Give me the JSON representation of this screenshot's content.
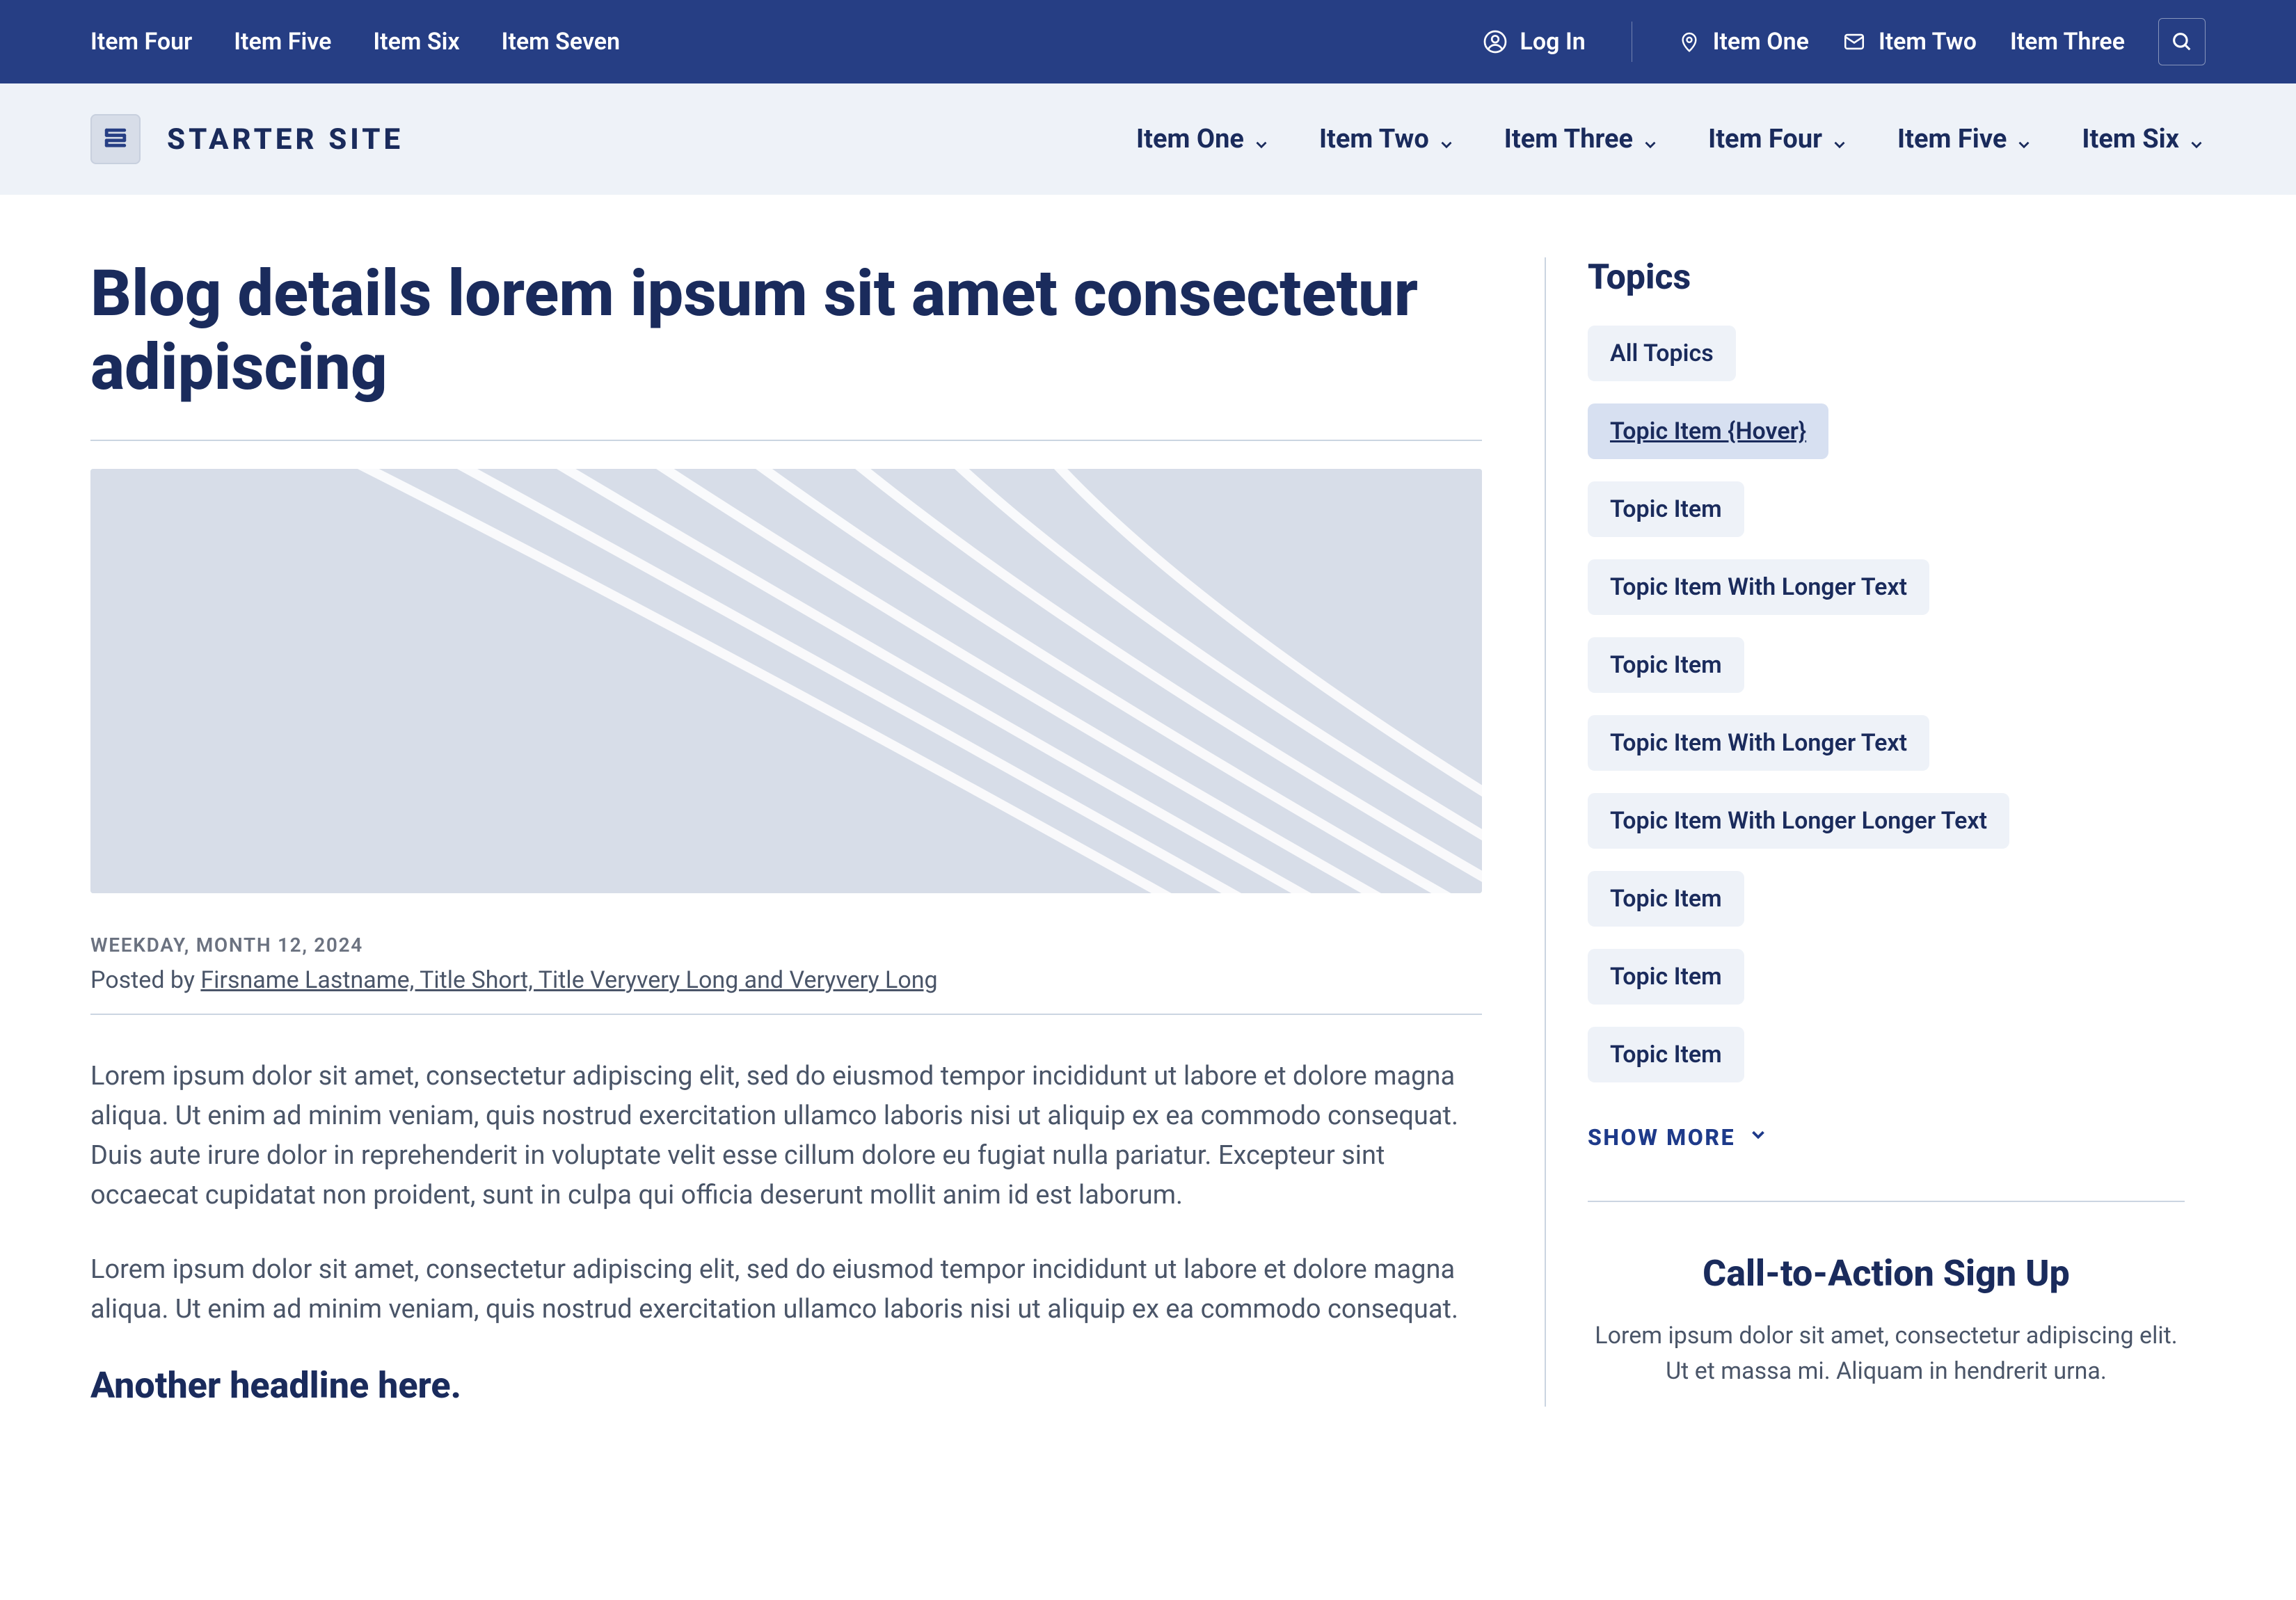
{
  "utility_bar": {
    "left_items": [
      {
        "label": "Item Four"
      },
      {
        "label": "Item Five"
      },
      {
        "label": "Item Six"
      },
      {
        "label": "Item Seven"
      }
    ],
    "login_label": "Log In",
    "right_items": [
      {
        "label": "Item One",
        "icon": "pin"
      },
      {
        "label": "Item Two",
        "icon": "mail"
      },
      {
        "label": "Item Three",
        "icon": null
      }
    ]
  },
  "brand": {
    "name": "STARTER SITE"
  },
  "main_nav": [
    {
      "label": "Item One"
    },
    {
      "label": "Item Two"
    },
    {
      "label": "Item Three"
    },
    {
      "label": "Item Four"
    },
    {
      "label": "Item Five"
    },
    {
      "label": "Item Six"
    }
  ],
  "article": {
    "title": "Blog details lorem ipsum sit amet consectetur adipiscing",
    "date": "WEEKDAY, MONTH 12, 2024",
    "byline_prefix": "Posted by ",
    "byline_link": "Firsname Lastname, Title Short, Title Veryvery Long and Veryvery Long",
    "paragraphs": [
      "Lorem ipsum dolor sit amet, consectetur adipiscing elit, sed do eiusmod tempor incididunt ut labore et dolore magna aliqua. Ut enim ad minim veniam, quis nostrud exercitation ullamco laboris nisi ut aliquip ex ea commodo consequat. Duis aute irure dolor in reprehenderit in voluptate velit esse cillum dolore eu fugiat nulla pariatur. Excepteur sint occaecat cupidatat non proident, sunt in culpa qui officia deserunt mollit anim id est laborum.",
      "Lorem ipsum dolor sit amet, consectetur adipiscing elit, sed do eiusmod tempor incididunt ut labore et dolore magna aliqua. Ut enim ad minim veniam, quis nostrud exercitation ullamco laboris nisi ut aliquip ex ea commodo consequat."
    ],
    "subheading": "Another headline here."
  },
  "sidebar": {
    "topics_heading": "Topics",
    "topics": [
      {
        "label": "All Topics",
        "state": "normal"
      },
      {
        "label": "Topic Item {Hover}",
        "state": "hover"
      },
      {
        "label": "Topic Item",
        "state": "normal"
      },
      {
        "label": "Topic Item With Longer Text",
        "state": "normal"
      },
      {
        "label": "Topic Item",
        "state": "normal"
      },
      {
        "label": "Topic Item With Longer Text",
        "state": "normal"
      },
      {
        "label": "Topic Item With Longer Longer Text",
        "state": "normal"
      },
      {
        "label": "Topic Item",
        "state": "normal"
      },
      {
        "label": "Topic Item",
        "state": "normal"
      },
      {
        "label": "Topic Item",
        "state": "normal"
      }
    ],
    "show_more_label": "SHOW MORE",
    "cta": {
      "title": "Call-to-Action Sign Up",
      "body": "Lorem ipsum dolor sit amet, consectetur adipiscing elit. Ut et massa mi. Aliquam in hendrerit urna."
    }
  }
}
